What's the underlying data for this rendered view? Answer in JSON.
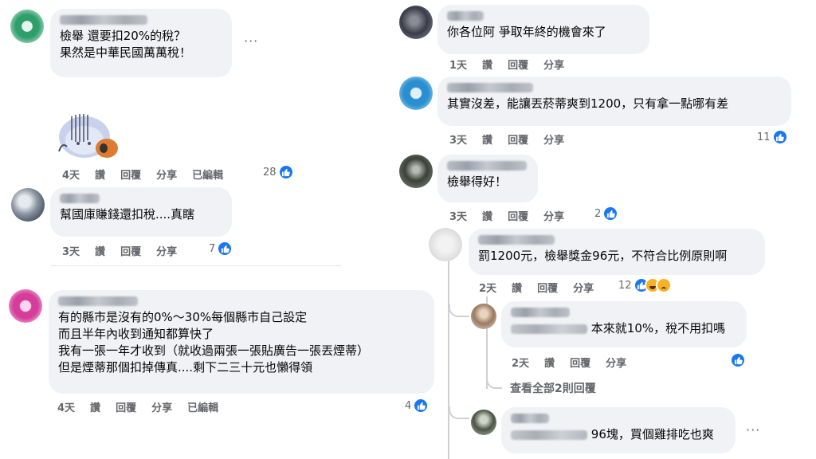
{
  "left": {
    "c1": {
      "line1": "檢舉 還要扣20%的稅？",
      "line2": "果然是中華民國萬萬稅！",
      "time": "4天",
      "like": "讚",
      "reply": "回覆",
      "share": "分享",
      "edited": "已編輯",
      "count": "28"
    },
    "c2": {
      "line1": "幫國庫賺錢還扣稅....真瞎",
      "time": "3天",
      "like": "讚",
      "reply": "回覆",
      "share": "分享",
      "count": "7"
    },
    "c3": {
      "line1": "有的縣市是沒有的0%～30%每個縣市自己設定",
      "line2": "而且半年內收到通知都算快了",
      "line3": "我有一張一年才收到（就收過兩張一張貼廣告一張丟煙蒂）",
      "line4": "但是煙蒂那個扣掉傳真....剩下二三十元也懶得領",
      "time": "4天",
      "like": "讚",
      "reply": "回覆",
      "share": "分享",
      "edited": "已編輯",
      "count": "4"
    }
  },
  "right": {
    "c1": {
      "line1": "你各位阿 爭取年終的機會來了",
      "time": "1天",
      "like": "讚",
      "reply": "回覆",
      "share": "分享"
    },
    "c2": {
      "line1": "其實沒差，能讓丟菸蒂爽到1200，只有拿一點哪有差",
      "time": "3天",
      "like": "讚",
      "reply": "回覆",
      "share": "分享",
      "count": "11"
    },
    "c3": {
      "line1": "檢舉得好！",
      "time": "3天",
      "like": "讚",
      "reply": "回覆",
      "share": "分享",
      "count": "2"
    },
    "r1": {
      "line1": "罰1200元，檢舉獎金96元，不符合比例原則啊",
      "time": "2天",
      "like": "讚",
      "reply": "回覆",
      "share": "分享",
      "count": "12"
    },
    "r2": {
      "line1": "本來就10%，稅不用扣嗎",
      "time": "2天",
      "like": "讚",
      "reply": "回覆",
      "share": "分享"
    },
    "view_replies": "查看全部2則回覆",
    "r3": {
      "line1": "96塊，買個雞排吃也爽"
    }
  },
  "icons": {
    "like": "thumbs-up-icon",
    "more": "more-dots-icon",
    "haha": "haha-reaction-icon",
    "sad": "sad-reaction-icon"
  },
  "colors": {
    "like_blue": "#1877f2",
    "bubble": "#f0f2f5",
    "meta_gray": "#65676b"
  }
}
